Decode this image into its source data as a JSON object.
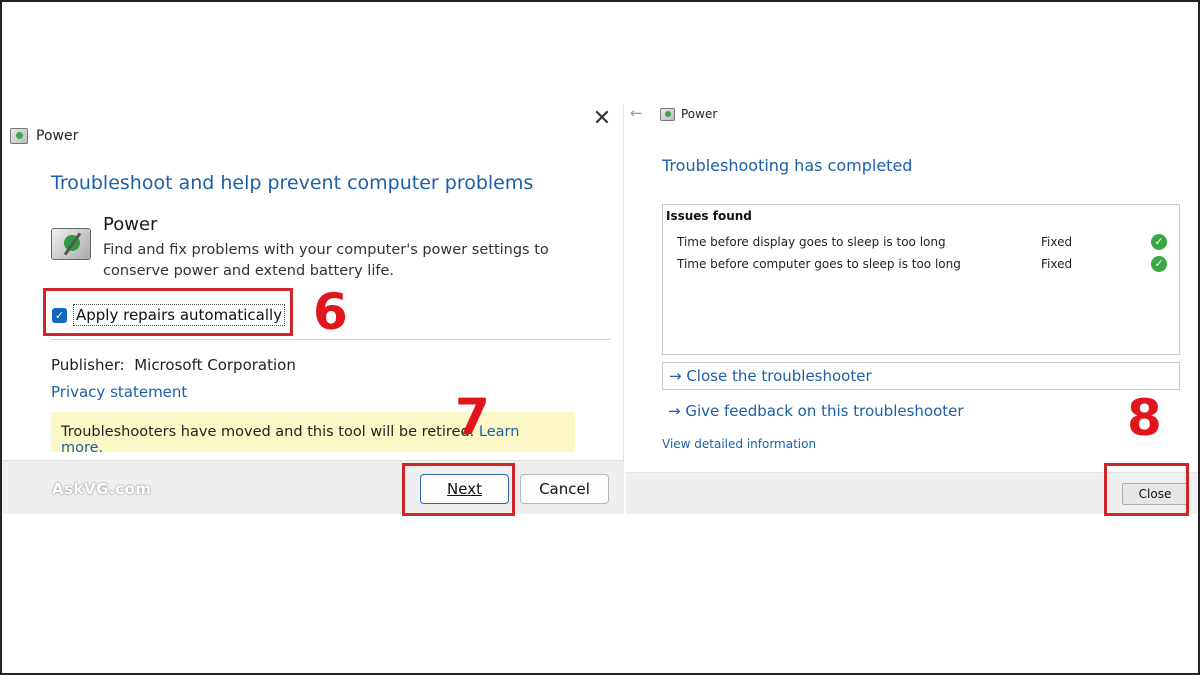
{
  "left_dialog": {
    "close_glyph": "✕",
    "title": "Power",
    "heading": "Troubleshoot and help prevent computer problems",
    "troubleshooter": {
      "name": "Power",
      "description": "Find and fix problems with your computer's power settings to conserve power and extend battery life.",
      "icon": "power-troubleshooter-icon"
    },
    "apply_repairs": {
      "label": "Apply repairs automatically",
      "checked": true
    },
    "publisher_label": "Publisher:",
    "publisher_value": "Microsoft Corporation",
    "privacy_link": "Privacy statement",
    "notice_text": "Troubleshooters have moved and this tool will be retired. ",
    "notice_link": "Learn more.",
    "watermark": "AskVG.com",
    "next_button": "Next",
    "cancel_button": "Cancel"
  },
  "right_dialog": {
    "back_glyph": "←",
    "title": "Power",
    "heading": "Troubleshooting has completed",
    "issues_header": "Issues found",
    "issues": [
      {
        "description": "Time before display goes to sleep is too long",
        "status": "Fixed"
      },
      {
        "description": "Time before computer goes to sleep is too long",
        "status": "Fixed"
      }
    ],
    "close_troubleshooter_link": "→ Close the troubleshooter",
    "feedback_link": "→ Give feedback on this troubleshooter",
    "detailed_link": "View detailed information",
    "close_button": "Close"
  },
  "annotations": {
    "step6": "6",
    "step7": "7",
    "step8": "8",
    "color": "#d0262b"
  },
  "colors": {
    "link_blue": "#1c5fa8",
    "notice_yellow": "#fcf8c8",
    "check_green": "#3aa845"
  }
}
